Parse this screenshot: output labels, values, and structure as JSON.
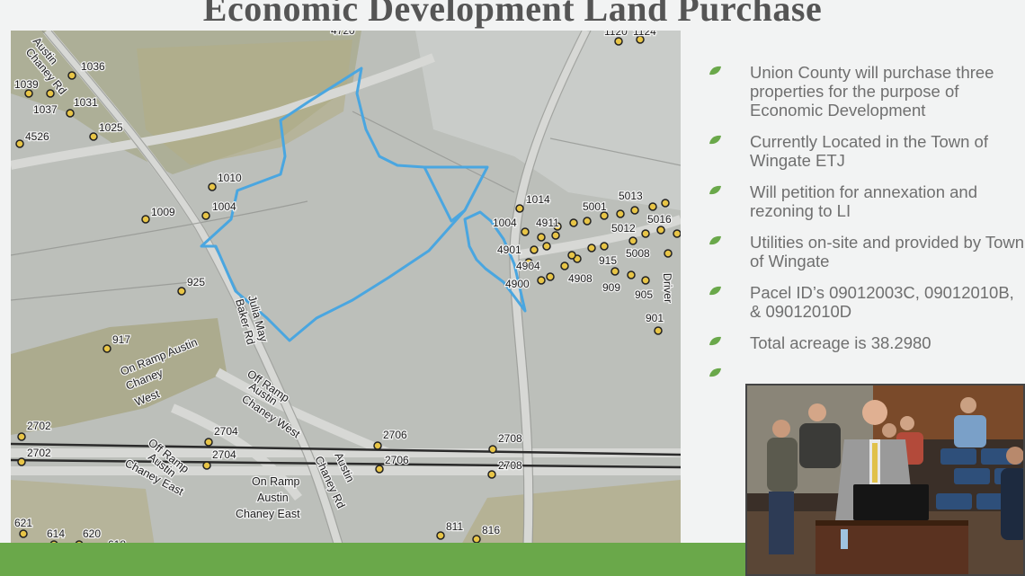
{
  "slide": {
    "title": "Economic Development Land Purchase"
  },
  "bullets": [
    "Union County will purchase three properties for the purpose of Economic Development",
    "Currently Located in the Town of Wingate ETJ",
    "Will petition for annexation and rezoning to LI",
    "Utilities on-site and provided by Town of Wingate",
    "Pacel ID’s 09012003C, 09012010B, & 09012010D",
    "Total acreage is 38.2980",
    ""
  ],
  "map": {
    "address_labels": [
      "1120",
      "1124",
      "1036",
      "1039",
      "1037",
      "1031",
      "4526",
      "1025",
      "1010",
      "1004",
      "1009",
      "1014",
      "5001",
      "5013",
      "5016",
      "5012",
      "5008",
      "1004",
      "4911",
      "4901",
      "4904",
      "4908",
      "4900",
      "915",
      "909",
      "905",
      "901",
      "925",
      "917",
      "2702",
      "2704",
      "2706",
      "2708",
      "2702",
      "2704",
      "2706",
      "2708",
      "621",
      "614",
      "620",
      "618",
      "811",
      "816",
      "4720"
    ],
    "street_labels": [
      "Austin",
      "Chaney Rd",
      "Julia May",
      "Baker Rd",
      "On Ramp Austin",
      "Chaney",
      "West",
      "Off Ramp",
      "Austin",
      "Chaney West",
      "Off Ramp",
      "Austin",
      "Chaney East",
      "On Ramp",
      "Austin",
      "Chaney East",
      "Austin",
      "Chaney Rd",
      "Driver"
    ],
    "colors": {
      "boundary": "#4aa6e0",
      "marker": "#e8c547",
      "footer": "#6aa84a"
    }
  },
  "video": {
    "description_icon": "camera-feed"
  }
}
